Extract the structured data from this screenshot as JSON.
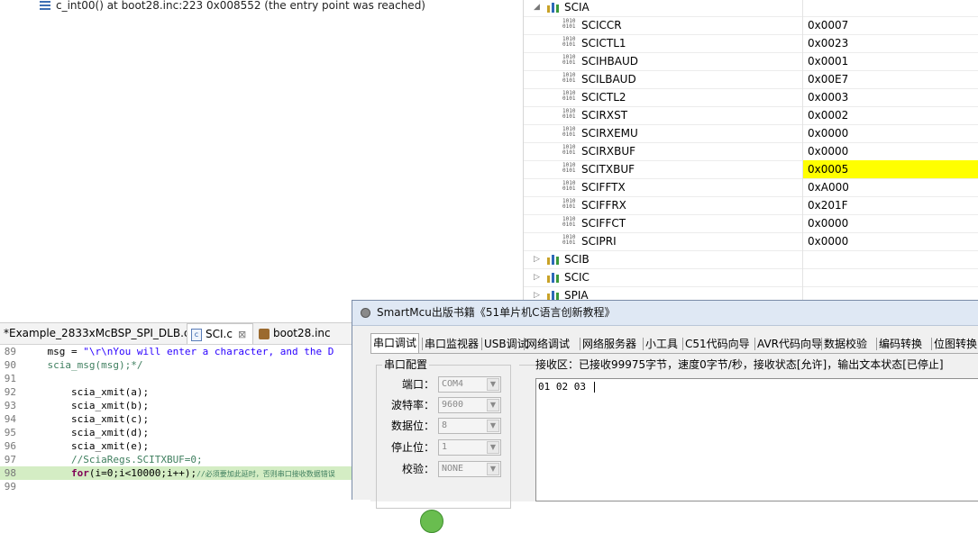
{
  "debug": {
    "frame_label": "c_int00() at boot28.inc:223 0x008552  (the entry point was reached)"
  },
  "registers": {
    "groups": [
      {
        "name": "SCIA",
        "expanded": true,
        "registers": [
          {
            "name": "SCICCR",
            "value": "0x0007",
            "highlight": false
          },
          {
            "name": "SCICTL1",
            "value": "0x0023",
            "highlight": false
          },
          {
            "name": "SCIHBAUD",
            "value": "0x0001",
            "highlight": false
          },
          {
            "name": "SCILBAUD",
            "value": "0x00E7",
            "highlight": false
          },
          {
            "name": "SCICTL2",
            "value": "0x0003",
            "highlight": false
          },
          {
            "name": "SCIRXST",
            "value": "0x0002",
            "highlight": false
          },
          {
            "name": "SCIRXEMU",
            "value": "0x0000",
            "highlight": false
          },
          {
            "name": "SCIRXBUF",
            "value": "0x0000",
            "highlight": false
          },
          {
            "name": "SCITXBUF",
            "value": "0x0005",
            "highlight": true
          },
          {
            "name": "SCIFFTX",
            "value": "0xA000",
            "highlight": false
          },
          {
            "name": "SCIFFRX",
            "value": "0x201F",
            "highlight": false
          },
          {
            "name": "SCIFFCT",
            "value": "0x0000",
            "highlight": false
          },
          {
            "name": "SCIPRI",
            "value": "0x0000",
            "highlight": false
          }
        ]
      },
      {
        "name": "SCIB",
        "expanded": false
      },
      {
        "name": "SCIC",
        "expanded": false
      },
      {
        "name": "SPIA",
        "expanded": false
      }
    ],
    "register_icon_text": "1010\n0101",
    "highlight_color": "#ffff00"
  },
  "editor": {
    "tabs": [
      {
        "label": "*Example_2833xMcBSP_SPI_DLB.c",
        "active": false
      },
      {
        "label": "SCI.c",
        "active": true,
        "close": "⊠"
      },
      {
        "label": "boot28.inc",
        "active": false
      }
    ],
    "lines": [
      {
        "num": "89",
        "segments": [
          {
            "t": "    msg = ",
            "c": ""
          },
          {
            "t": "\"\\r\\nYou will enter a character, and the D",
            "c": "str"
          }
        ]
      },
      {
        "num": "90",
        "segments": [
          {
            "t": "    scia_msg(msg);*/",
            "c": "cmt"
          }
        ]
      },
      {
        "num": "91",
        "segments": []
      },
      {
        "num": "92",
        "segments": [
          {
            "t": "        scia_xmit(a);",
            "c": ""
          }
        ]
      },
      {
        "num": "93",
        "segments": [
          {
            "t": "        scia_xmit(b);",
            "c": ""
          }
        ]
      },
      {
        "num": "94",
        "segments": [
          {
            "t": "        scia_xmit(c);",
            "c": ""
          }
        ]
      },
      {
        "num": "95",
        "segments": [
          {
            "t": "        scia_xmit(d);",
            "c": ""
          }
        ]
      },
      {
        "num": "96",
        "segments": [
          {
            "t": "        scia_xmit(e);",
            "c": ""
          }
        ]
      },
      {
        "num": "97",
        "segments": [
          {
            "t": "        //SciaRegs.SCITXBUF=0;",
            "c": "cmt"
          }
        ]
      },
      {
        "num": "98",
        "current": true,
        "segments": [
          {
            "t": "        ",
            "c": ""
          },
          {
            "t": "for",
            "c": "kw"
          },
          {
            "t": "(i=0;i<10000;i++);",
            "c": ""
          },
          {
            "t": "//必须要加此延时，否则串口接收数据错误",
            "c": "cmt-small"
          }
        ]
      },
      {
        "num": "99",
        "segments": []
      }
    ]
  },
  "serial_tool": {
    "title": "SmartMcu出版书籍《51单片机C语言创新教程》",
    "tabs": [
      "串口调试",
      "串口监视器",
      "USB调试",
      "网络调试",
      "网络服务器",
      "小工具",
      "C51代码向导",
      "AVR代码向导",
      "数据校验",
      "编码转换",
      "位图转换"
    ],
    "active_tab": 0,
    "config": {
      "legend": "串口配置",
      "fields": [
        {
          "label": "端口：",
          "value": "COM4"
        },
        {
          "label": "波特率：",
          "value": "9600"
        },
        {
          "label": "数据位：",
          "value": "8"
        },
        {
          "label": "停止位：",
          "value": "1"
        },
        {
          "label": "校验：",
          "value": "NONE"
        }
      ]
    },
    "receive": {
      "status": "接收区：已接收99975字节，速度0字节/秒，接收状态[允许]，输出文本状态[已停止]",
      "content": "01 02 03 "
    }
  }
}
